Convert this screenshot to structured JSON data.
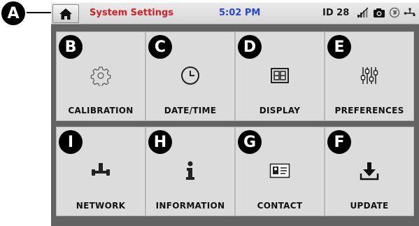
{
  "callout": "A",
  "topbar": {
    "title": "System Settings",
    "time": "5:02 PM",
    "id_text": "ID 28"
  },
  "tiles": [
    {
      "label": "CALIBRATION",
      "badge": "B",
      "icon": "gear-icon"
    },
    {
      "label": "DATE/TIME",
      "badge": "C",
      "icon": "clock-icon"
    },
    {
      "label": "DISPLAY",
      "badge": "D",
      "icon": "display-icon"
    },
    {
      "label": "PREFERENCES",
      "badge": "E",
      "icon": "sliders-icon"
    },
    {
      "label": "NETWORK",
      "badge": "I",
      "icon": "network-icon"
    },
    {
      "label": "INFORMATION",
      "badge": "H",
      "icon": "info-icon"
    },
    {
      "label": "CONTACT",
      "badge": "G",
      "icon": "contact-card-icon"
    },
    {
      "label": "UPDATE",
      "badge": "F",
      "icon": "download-icon"
    }
  ]
}
